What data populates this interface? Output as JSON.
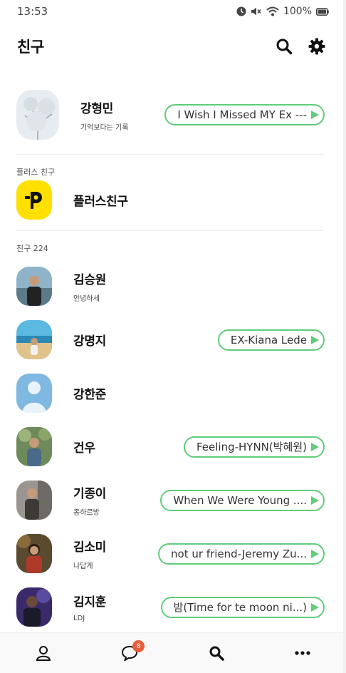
{
  "status_bar": {
    "time": "13:53",
    "battery": "100%"
  },
  "header": {
    "title": "친구"
  },
  "me": {
    "name": "강형민",
    "status": "기억보다는 기록",
    "music": "I Wish I Missed MY Ex ---"
  },
  "plus_section": {
    "label": "플러스 친구",
    "name": "플러스친구"
  },
  "friends_section": {
    "label": "친구 224"
  },
  "friends": [
    {
      "name": "김승원",
      "status": "안녕하세",
      "music": ""
    },
    {
      "name": "강명지",
      "status": "",
      "music": "EX-Kiana Lede"
    },
    {
      "name": "강한준",
      "status": "",
      "music": ""
    },
    {
      "name": "건우",
      "status": "",
      "music": "Feeling-HYNN(박혜원)"
    },
    {
      "name": "기종이",
      "status": "종하르방",
      "music": "When We Were Young ...."
    },
    {
      "name": "김소미",
      "status": "나답게",
      "music": "not ur friend-Jeremy Zu..."
    },
    {
      "name": "김지훈",
      "status": "LDJ",
      "music": "밤(Time for te moon ni...)"
    }
  ],
  "tabbar": {
    "chat_badge": "8"
  },
  "colors": {
    "accent": "#5fcd7b",
    "badge": "#e85d3b",
    "plus_yellow": "#ffe000"
  }
}
